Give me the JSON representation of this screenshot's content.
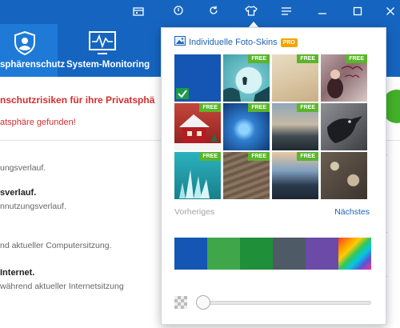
{
  "nav": {
    "tabs": [
      {
        "label": "sphärenschutz",
        "icon": "shield-user-icon",
        "active": true
      },
      {
        "label": "System-Monitoring",
        "icon": "pulse-monitor-icon",
        "active": false
      }
    ]
  },
  "titlebar": {
    "icons": [
      "gift-card-icon",
      "power-icon",
      "refresh-icon",
      "skin-shirt-icon",
      "menu-list-icon",
      "minimize-icon",
      "maximize-icon",
      "close-icon"
    ]
  },
  "main": {
    "alert_title": "nschutzrisiken für ihre Privatsphä",
    "alert_subtitle": "atsphäre gefunden!",
    "rows": [
      {
        "title": "",
        "subtitle": "ungsverlauf."
      },
      {
        "title": "sverlauf.",
        "subtitle": "nnutzungsverlauf."
      },
      {
        "title": "",
        "subtitle": "nd aktueller Computersitzung."
      },
      {
        "title": "Internet.",
        "subtitle": "während aktueller Internetsitzung"
      }
    ]
  },
  "skins": {
    "header": "Individuelle Foto-Skins",
    "pro_badge": "PRO",
    "free_label": "FREE",
    "prev_label": "Vorheriges",
    "next_label": "Nächstes",
    "selected_index": 0,
    "items": [
      {
        "name": "blue",
        "free": false
      },
      {
        "name": "moon-night",
        "free": true
      },
      {
        "name": "parchment",
        "free": true
      },
      {
        "name": "valentines-day",
        "free": true
      },
      {
        "name": "red-house-snow",
        "free": true
      },
      {
        "name": "blue-galaxy",
        "free": true
      },
      {
        "name": "lake-sunset",
        "free": true
      },
      {
        "name": "crow",
        "free": false
      },
      {
        "name": "ice-crystal",
        "free": true
      },
      {
        "name": "wooden-boardwalk",
        "free": true
      },
      {
        "name": "beach-sunset",
        "free": true
      },
      {
        "name": "bokeh",
        "free": false
      }
    ],
    "swatches": [
      "#1556b4",
      "#3fa64a",
      "#1f8f3a",
      "#4e5a66",
      "#6b4aa8",
      "rainbow"
    ],
    "opacity_level": 0.02
  }
}
